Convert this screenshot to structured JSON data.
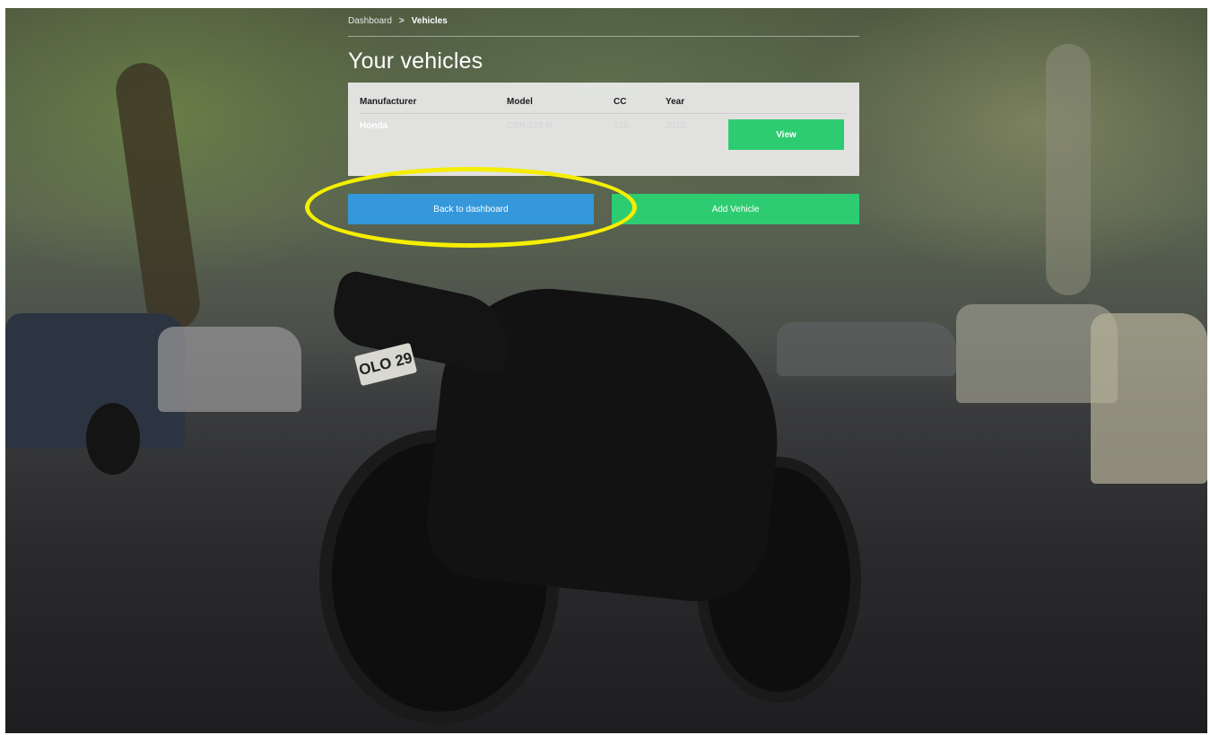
{
  "breadcrumb": {
    "items": [
      "Dashboard",
      "Vehicles"
    ],
    "separator": ">"
  },
  "page": {
    "title": "Your vehicles"
  },
  "table": {
    "columns": [
      "Manufacturer",
      "Model",
      "CC",
      "Year"
    ],
    "rows": [
      {
        "manufacturer": "Honda",
        "model": "CBR 125 R",
        "cc": "125",
        "year": "2013",
        "action_label": "View"
      }
    ]
  },
  "actions": {
    "back_label": "Back to dashboard",
    "add_label": "Add Vehicle"
  },
  "background": {
    "plate_text": "OLO 29"
  },
  "colors": {
    "primary_green": "#2ecc71",
    "primary_blue": "#3498db",
    "highlight_yellow": "#f5ee00"
  }
}
